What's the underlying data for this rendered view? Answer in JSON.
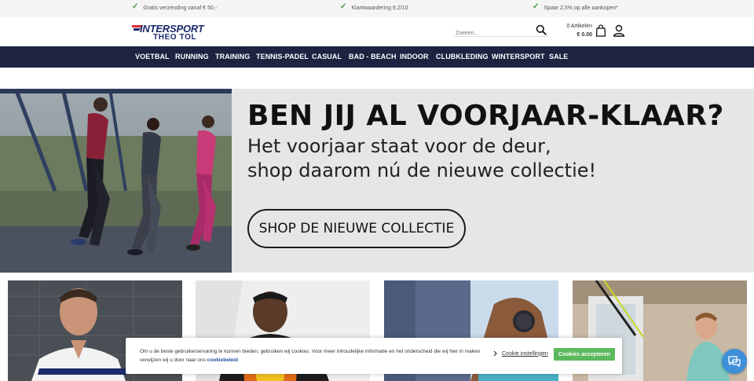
{
  "usps": [
    {
      "text": "Gratis verzending vanaf € 50,-"
    },
    {
      "text": "Klantwaardering 9,2/10"
    },
    {
      "text": "Spaar 2,5% op alle aankopen*"
    }
  ],
  "logo": {
    "brand": "INTERSPORT",
    "subtitle": "THEO TOL"
  },
  "search": {
    "placeholder": "Zoeken..."
  },
  "cart": {
    "items": "0 Artikelen",
    "amount": "€ 0.00"
  },
  "nav": {
    "items": [
      {
        "label": "VOETBAL"
      },
      {
        "label": "RUNNING"
      },
      {
        "label": "TRAINING"
      },
      {
        "label": "TENNIS-PADEL"
      },
      {
        "label": "CASUAL"
      },
      {
        "label": "BAD - BEACH"
      },
      {
        "label": "INDOOR"
      },
      {
        "label": "CLUBKLEDING"
      },
      {
        "label": "WINTERSPORT"
      },
      {
        "label": "SALE"
      }
    ]
  },
  "hero": {
    "title": "BEN JIJ AL VOORJAAR-KLAAR?",
    "subtitle_line1": "Het voorjaar staat voor de deur,",
    "subtitle_line2": "shop daarom nú de nieuwe collectie!",
    "button_label": "SHOP DE NIEUWE COLLECTIE"
  },
  "cookie": {
    "message": "Om u de beste gebruikerservaring te kunnen bieden, gebruiken wij cookies. Voor meer inhoudelijke informatie en het onderscheid die wij hier in maken verwijzen wij u door naar ons",
    "link_label": "cookiebeleid",
    "settings_label": "Cookie instellingen",
    "accept_label": "Cookies accepteren"
  },
  "colors": {
    "nav_bg": "#1c2442",
    "brand_blue": "#1a2a6c",
    "brand_red": "#d7282f",
    "accept_green": "#5cb85c",
    "check_green": "#3a9a3a",
    "chat_blue": "#3f8fd8"
  },
  "icons": [
    "check-icon",
    "search-icon",
    "shopping-bag-icon",
    "user-icon",
    "chevron-right-icon",
    "chat-icon"
  ]
}
